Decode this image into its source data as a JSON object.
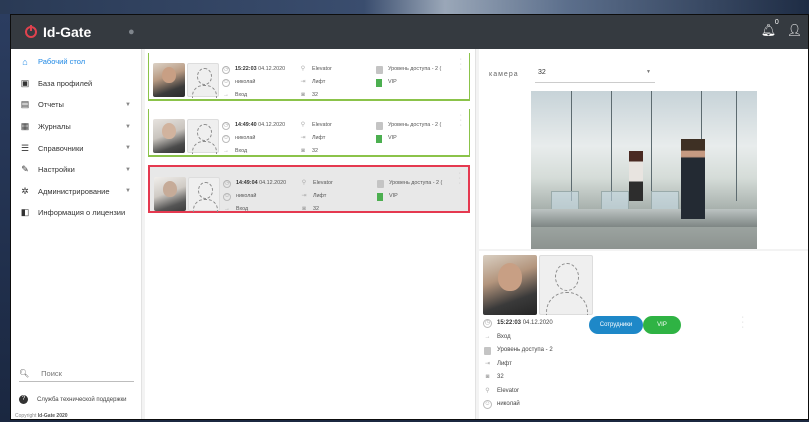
{
  "app": {
    "title": "Id-Gate",
    "notifications": "0"
  },
  "sidebar": {
    "items": [
      {
        "label": "Рабочий стол",
        "icon": "home-icon",
        "glyph": "⌂",
        "active": true,
        "expandable": false
      },
      {
        "label": "База профилей",
        "icon": "id-card-icon",
        "glyph": "▣",
        "active": false,
        "expandable": false
      },
      {
        "label": "Отчеты",
        "icon": "report-icon",
        "glyph": "▤",
        "active": false,
        "expandable": true
      },
      {
        "label": "Журналы",
        "icon": "journal-icon",
        "glyph": "▦",
        "active": false,
        "expandable": true
      },
      {
        "label": "Справочники",
        "icon": "list-icon",
        "glyph": "☰",
        "active": false,
        "expandable": true
      },
      {
        "label": "Настройки",
        "icon": "wrench-icon",
        "glyph": "✎",
        "active": false,
        "expandable": true
      },
      {
        "label": "Администрирование",
        "icon": "gear-icon",
        "glyph": "✲",
        "active": false,
        "expandable": true
      },
      {
        "label": "Информация о лицензии",
        "icon": "license-icon",
        "glyph": "◧",
        "active": false,
        "expandable": false
      }
    ],
    "search_placeholder": "Поиск",
    "support_label": "Служба технической поддержки",
    "copyright_prefix": "Copyright ",
    "copyright_brand": "Id-Gate 2020"
  },
  "events": [
    {
      "time": "15:22:03",
      "date": "04.12.2020",
      "person": "николай",
      "direction": "Вход",
      "location": "Elevator",
      "device": "Лифт",
      "camera": "32",
      "access": "Уровень доступа - 2 (",
      "group": "VIP",
      "selected": false
    },
    {
      "time": "14:49:40",
      "date": "04.12.2020",
      "person": "николай",
      "direction": "Вход",
      "location": "Elevator",
      "device": "Лифт",
      "camera": "32",
      "access": "Уровень доступа - 2 (",
      "group": "VIP",
      "selected": false
    },
    {
      "time": "14:49:04",
      "date": "04.12.2020",
      "person": "николай",
      "direction": "Вход",
      "location": "Elevator",
      "device": "Лифт",
      "camera": "32",
      "access": "Уровень доступа - 2 (",
      "group": "VIP",
      "selected": true
    }
  ],
  "camera": {
    "label": "камера",
    "selected": "32"
  },
  "detail": {
    "time": "15:22:03",
    "date": "04.12.2020",
    "direction": "Вход",
    "access": "Уровень доступа - 2",
    "device": "Лифт",
    "camera": "32",
    "location": "Elevator",
    "person": "николай",
    "badges": [
      {
        "label": "Сотрудники",
        "color": "#1e88c8"
      },
      {
        "label": "VIP",
        "color": "#2fb344"
      }
    ]
  },
  "colors": {
    "accent": "#1e88e5",
    "topbar": "#353a40",
    "ok": "#8bc34a",
    "selected": "#e53950"
  }
}
